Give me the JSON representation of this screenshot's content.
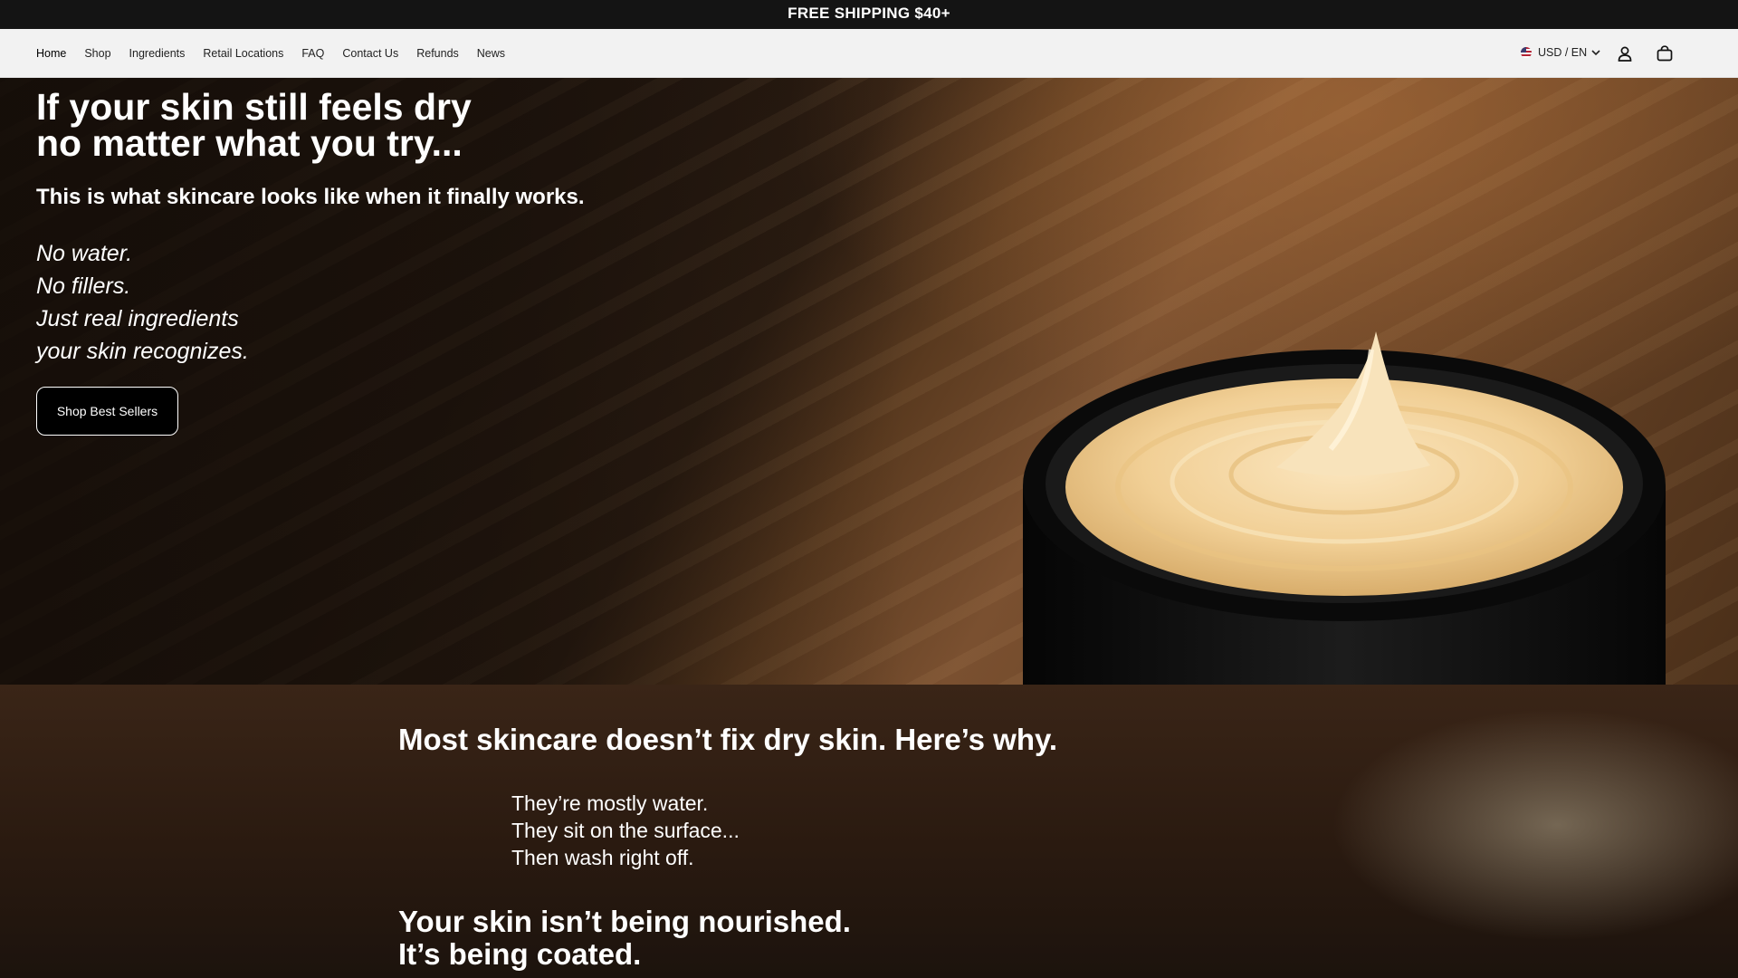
{
  "announcement": "FREE SHIPPING $40+",
  "nav": {
    "links": [
      "Home",
      "Shop",
      "Ingredients",
      "Retail Locations",
      "FAQ",
      "Contact Us",
      "Refunds",
      "News"
    ],
    "currency": "USD / EN",
    "icons": {
      "flag": "us-flag-icon",
      "chevron": "chevron-down-icon",
      "account": "user-icon",
      "cart": "shopping-bag-icon"
    }
  },
  "hero": {
    "title_lines": [
      "If your skin still feels dry",
      "no matter what you try..."
    ],
    "subtitle": "This is what skincare looks like when it finally works.",
    "lines": [
      "No water.",
      "No fillers.",
      "Just real ingredients",
      "your skin recognizes."
    ],
    "cta": "Shop Best Sellers"
  },
  "problem": {
    "title": "Most skincare doesn’t fix dry skin. Here’s why.",
    "lines": [
      "They’re mostly water.",
      "They sit on the surface...",
      "Then wash right off."
    ],
    "closing_lines": [
      "Your skin isn’t being nourished.",
      "It’s being coated."
    ]
  }
}
